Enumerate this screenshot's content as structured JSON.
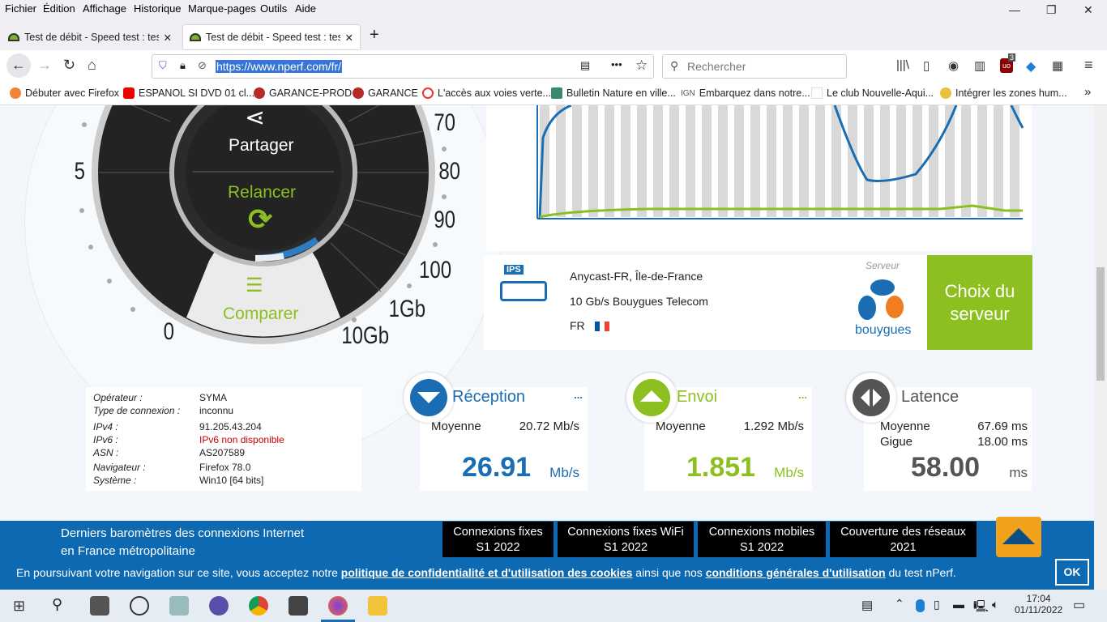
{
  "menu": [
    "Fichier",
    "Édition",
    "Affichage",
    "Historique",
    "Marque-pages",
    "Outils",
    "Aide"
  ],
  "tabs": [
    {
      "title": "Test de débit - Speed test : teste"
    },
    {
      "title": "Test de débit - Speed test : teste"
    }
  ],
  "url": "https://www.nperf.com/fr/",
  "search_placeholder": "Rechercher",
  "badge": "3",
  "bookmarks": [
    "Débuter avec Firefox",
    "ESPANOL SI DVD 01 cl...",
    "GARANCE-PROD",
    "GARANCE",
    "L'accès aux voies verte...",
    "Bulletin Nature en ville...",
    "Embarquez dans notre...",
    "Le club Nouvelle-Aqui...",
    "Intégrer les zones hum..."
  ],
  "gauge": {
    "labels": [
      "5",
      "0",
      "70",
      "80",
      "90",
      "100",
      "1Gb",
      "10Gb"
    ],
    "share": "Partager",
    "restart": "Relancer",
    "compare": "Comparer"
  },
  "server": {
    "name": "Anycast-FR, Île-de-France",
    "isp": "10 Gb/s Bouygues Telecom",
    "country": "FR",
    "label": "Serveur",
    "logo_text": "bouygues",
    "ips": "IPS",
    "choose": "Choix du serveur"
  },
  "info": [
    [
      "Opérateur :",
      "SYMA"
    ],
    [
      "Type de connexion :",
      "inconnu"
    ],
    [
      "IPv4 :",
      "91.205.43.204"
    ],
    [
      "IPv6 :",
      "IPv6 non disponible"
    ],
    [
      "ASN :",
      "AS207589"
    ],
    [
      "Navigateur :",
      "Firefox 78.0"
    ],
    [
      "Système :",
      "Win10 [64 bits]"
    ]
  ],
  "reception": {
    "title": "Réception",
    "avg_label": "Moyenne",
    "avg": "20.72 Mb/s",
    "value": "26.91",
    "unit": "Mb/s",
    "more": "..."
  },
  "envoi": {
    "title": "Envoi",
    "avg_label": "Moyenne",
    "avg": "1.292 Mb/s",
    "value": "1.851",
    "unit": "Mb/s",
    "more": "..."
  },
  "latence": {
    "title": "Latence",
    "avg_label": "Moyenne",
    "avg": "67.69 ms",
    "jitter_label": "Gigue",
    "jitter": "18.00 ms",
    "value": "58.00",
    "unit": "ms"
  },
  "banner": {
    "text1": "Derniers baromètres des connexions Internet",
    "text2": "en France métropolitaine",
    "buttons": [
      [
        "Connexions fixes",
        "S1 2022"
      ],
      [
        "Connexions fixes WiFi",
        "S1 2022"
      ],
      [
        "Connexions mobiles",
        "S1 2022"
      ],
      [
        "Couverture des réseaux",
        "2021"
      ]
    ]
  },
  "cookie": {
    "t1": "En poursuivant votre navigation sur ce site, vous acceptez notre ",
    "l1": "politique de confidentialité et d'utilisation des cookies",
    "t2": " ainsi que nos ",
    "l2": "conditions générales d'utilisation",
    "t3": " du test nPerf.",
    "ok": "OK"
  },
  "clock": {
    "time": "17:04",
    "date": "01/11/2022"
  },
  "colors": {
    "blue": "#1a6db3",
    "green": "#8cbf1f",
    "banner": "#0d69b1"
  }
}
